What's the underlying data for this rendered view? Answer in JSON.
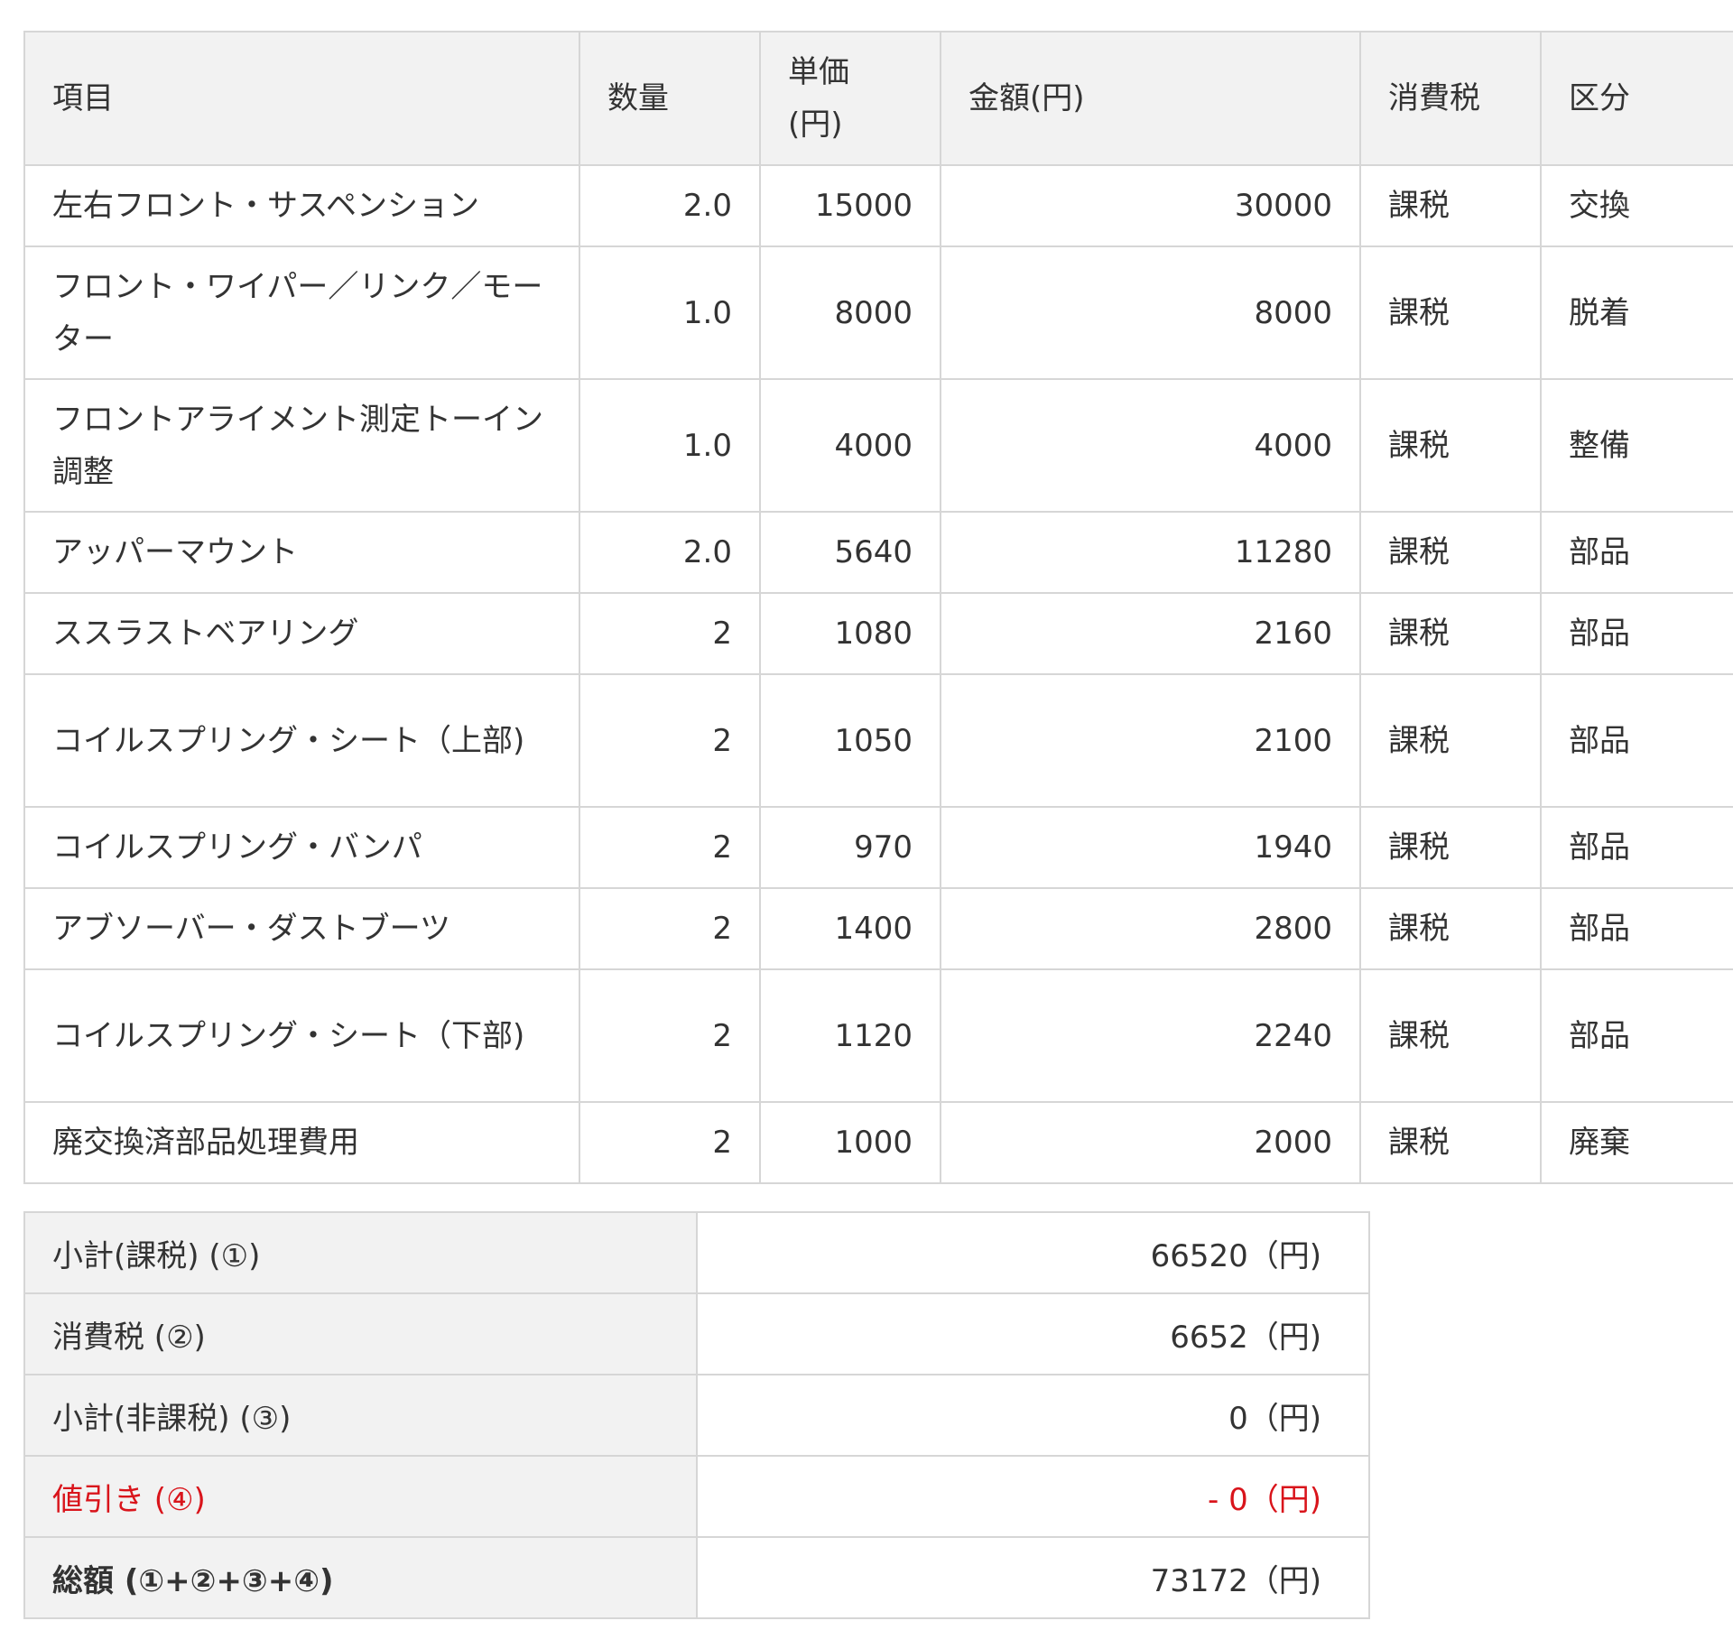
{
  "items_table": {
    "headers": {
      "item": "項目",
      "qty": "数量",
      "unit_price_line1": "単価",
      "unit_price_line2": "(円)",
      "amount": "金額(円)",
      "tax": "消費税",
      "category": "区分"
    },
    "rows": [
      {
        "item": "左右フロント・サスペンション",
        "qty": "2.0",
        "unit_price": "15000",
        "amount": "30000",
        "tax": "課税",
        "category": "交換"
      },
      {
        "item": "フロント・ワイパー／リンク／モーター",
        "qty": "1.0",
        "unit_price": "8000",
        "amount": "8000",
        "tax": "課税",
        "category": "脱着"
      },
      {
        "item": "フロントアライメント測定トーイン調整",
        "qty": "1.0",
        "unit_price": "4000",
        "amount": "4000",
        "tax": "課税",
        "category": "整備"
      },
      {
        "item": "アッパーマウント",
        "qty": "2.0",
        "unit_price": "5640",
        "amount": "11280",
        "tax": "課税",
        "category": "部品"
      },
      {
        "item": "ススラストベアリング",
        "qty": "2",
        "unit_price": "1080",
        "amount": "2160",
        "tax": "課税",
        "category": "部品"
      },
      {
        "item": "コイルスプリング・シート（上部)",
        "qty": "2",
        "unit_price": "1050",
        "amount": "2100",
        "tax": "課税",
        "category": "部品"
      },
      {
        "item": "コイルスプリング・バンパ",
        "qty": "2",
        "unit_price": "970",
        "amount": "1940",
        "tax": "課税",
        "category": "部品"
      },
      {
        "item": "アブソーバー・ダストブーツ",
        "qty": "2",
        "unit_price": "1400",
        "amount": "2800",
        "tax": "課税",
        "category": "部品"
      },
      {
        "item": "コイルスプリング・シート（下部)",
        "qty": "2",
        "unit_price": "1120",
        "amount": "2240",
        "tax": "課税",
        "category": "部品"
      },
      {
        "item": "廃交換済部品処理費用",
        "qty": "2",
        "unit_price": "1000",
        "amount": "2000",
        "tax": "課税",
        "category": "廃棄"
      }
    ]
  },
  "totals": {
    "subtotal_taxable": {
      "label": "小計(課税) (①)",
      "value": "66520（円)"
    },
    "consumption_tax": {
      "label": "消費税 (②)",
      "value": "6652（円)"
    },
    "subtotal_nontaxable": {
      "label": "小計(非課税) (③)",
      "value": "0（円)"
    },
    "discount": {
      "label": "値引き (④)",
      "value": "- 0（円)"
    },
    "grand_total": {
      "label": "総額 (①+②+③+④)",
      "value": "73172（円)"
    }
  },
  "colors": {
    "header_bg": "#f2f2f2",
    "border": "#d6d6d6",
    "text": "#333333",
    "discount": "#d9141b"
  }
}
